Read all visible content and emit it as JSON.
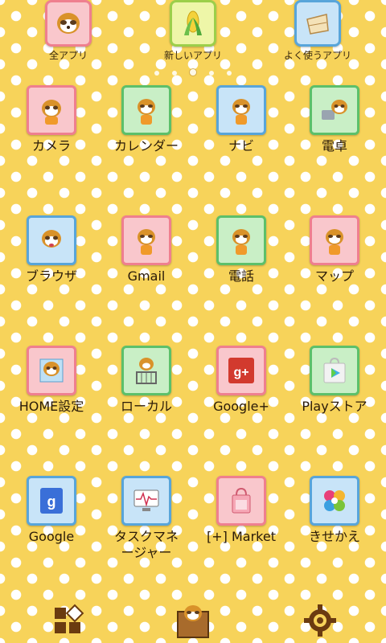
{
  "top": {
    "items": [
      {
        "label": "全アプリ"
      },
      {
        "label": "新しいアプリ"
      },
      {
        "label": "よく使うアプリ"
      }
    ]
  },
  "apps": [
    {
      "label": "カメラ",
      "tile": "pink",
      "icon": "raccoon-camera-icon"
    },
    {
      "label": "カレンダー",
      "tile": "green",
      "icon": "raccoon-calendar-icon"
    },
    {
      "label": "ナビ",
      "tile": "blue",
      "icon": "raccoon-navi-icon"
    },
    {
      "label": "電卓",
      "tile": "green",
      "icon": "raccoon-calculator-icon"
    },
    {
      "label": "ブラウザ",
      "tile": "blue",
      "icon": "raccoon-browser-icon"
    },
    {
      "label": "Gmail",
      "tile": "pink",
      "icon": "raccoon-gmail-icon"
    },
    {
      "label": "電話",
      "tile": "green",
      "icon": "raccoon-phone-icon"
    },
    {
      "label": "マップ",
      "tile": "pink",
      "icon": "raccoon-map-icon"
    },
    {
      "label": "HOME設定",
      "tile": "pink",
      "icon": "raccoon-home-settings-icon"
    },
    {
      "label": "ローカル",
      "tile": "green",
      "icon": "raccoon-local-icon"
    },
    {
      "label": "Google+",
      "tile": "pink",
      "icon": "google-plus-icon"
    },
    {
      "label": "Playストア",
      "tile": "green",
      "icon": "play-store-icon"
    },
    {
      "label": "Google",
      "tile": "blue",
      "icon": "google-search-icon"
    },
    {
      "label": "タスクマネージャー",
      "tile": "blue",
      "icon": "task-manager-icon"
    },
    {
      "label": "[+] Market",
      "tile": "pink",
      "icon": "market-bag-icon"
    },
    {
      "label": "きせかえ",
      "tile": "blue",
      "icon": "kisekae-icon"
    }
  ],
  "colors": {
    "background": "#f7d35a",
    "dot": "#ffffff",
    "label_text": "#2a1a08"
  }
}
